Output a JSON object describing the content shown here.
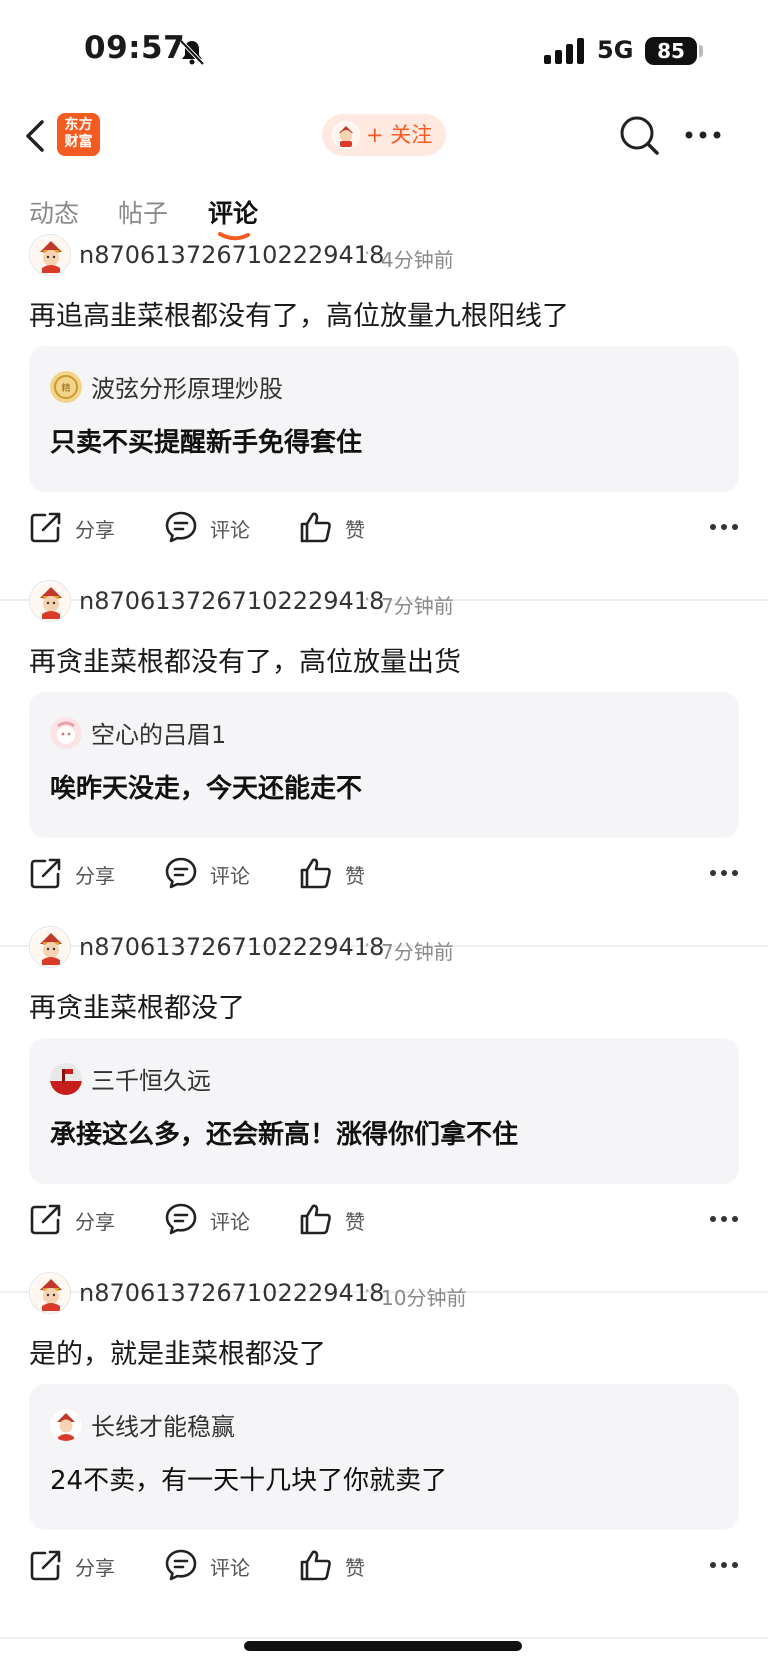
{
  "status_bar": {
    "time": "09:57",
    "network": "5G",
    "battery": "85"
  },
  "nav": {
    "logo_line1": "东方",
    "logo_line2": "财富",
    "follow_label": "+ 关注"
  },
  "tabs": [
    {
      "label": "动态",
      "active": false
    },
    {
      "label": "帖子",
      "active": false
    },
    {
      "label": "评论",
      "active": true
    }
  ],
  "colors": {
    "accent": "#f45b20",
    "quote_bg": "#f5f5f7"
  },
  "actions": {
    "share": "分享",
    "comment": "评论",
    "like": "赞"
  },
  "posts": [
    {
      "user": "n8706137267102229418",
      "dot": "·",
      "time": "4分钟前",
      "text": "再追高韭菜根都没有了，高位放量九根阳线了",
      "quote_user": "波弦分形原理炒股",
      "quote_text": "只卖不买提醒新手免得套住",
      "quote_avatar_icon": "gold-coin-avatar"
    },
    {
      "user": "n8706137267102229418",
      "dot": "·",
      "time": "7分钟前",
      "text": "再贪韭菜根都没有了，高位放量出货",
      "quote_user": "空心的吕眉1",
      "quote_text": "唉昨天没走，今天还能走不",
      "quote_avatar_icon": "pink-face-avatar"
    },
    {
      "user": "n8706137267102229418",
      "dot": "·",
      "time": "7分钟前",
      "text": "再贪韭菜根都没了",
      "quote_user": "三千恒久远",
      "quote_text": "承接这么多，还会新高！涨得你们拿不住",
      "quote_avatar_icon": "red-scene-avatar"
    },
    {
      "user": "n8706137267102229418",
      "dot": "·",
      "time": "10分钟前",
      "text": "是的，就是韭菜根都没了",
      "quote_user": "长线才能稳赢",
      "quote_text": "24不卖，有一天十几块了你就卖了",
      "quote_avatar_icon": "fortune-god-avatar"
    }
  ]
}
